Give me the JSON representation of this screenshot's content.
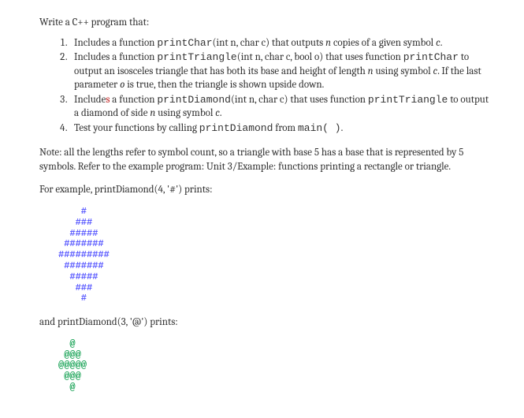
{
  "intro": "Write a C++ program that:",
  "items": [
    {
      "pre": "Includes a function ",
      "code1": "printChar",
      "mid1": "(int n, char c) that outputs ",
      "ital1": "n",
      "mid2": " copies of a given symbol ",
      "ital2": "c",
      "post": "."
    },
    {
      "pre": "Includes a function ",
      "code1": "printTriangle",
      "mid1": "(int n, char c, bool o) that uses function ",
      "code2": "printChar",
      "mid2": " to output an isosceles triangle that has both its base and height of length ",
      "ital1": "n",
      "mid3": " using symbol ",
      "ital2": "c",
      "mid4": ". If the last parameter ",
      "ital3": "o",
      "post": " is true, then the triangle is shown upside down."
    },
    {
      "pre": "Include",
      "redchar": "s",
      "mid0": " a function ",
      "code1": "printDiamond",
      "mid1": "(int n, char c) that uses function ",
      "code2": "printTriangle",
      "mid2": " to output a diamond of side ",
      "ital1": "n",
      "mid3": " using symbol ",
      "ital2": "c",
      "post": "."
    },
    {
      "pre": "Test your functions by calling ",
      "code1": "printDiamond",
      "mid1": " from ",
      "code2": "main( )",
      "post": "."
    }
  ],
  "note": "Note: all the lengths refer to symbol count, so a triangle with base 5 has a base that is represented by 5 symbols. Refer to the example program: Unit 3/Example: functions printing a rectangle or triangle.",
  "exampleIntro": "For example, printDiamond(4, '#') prints:",
  "diamond1": "    #\n   ###\n  #####\n #######\n#########\n #######\n  #####\n   ###\n    #",
  "secondIntro": "and printDiamond(3, '@') prints:",
  "diamond2": "  @\n @@@\n@@@@@\n @@@\n  @"
}
